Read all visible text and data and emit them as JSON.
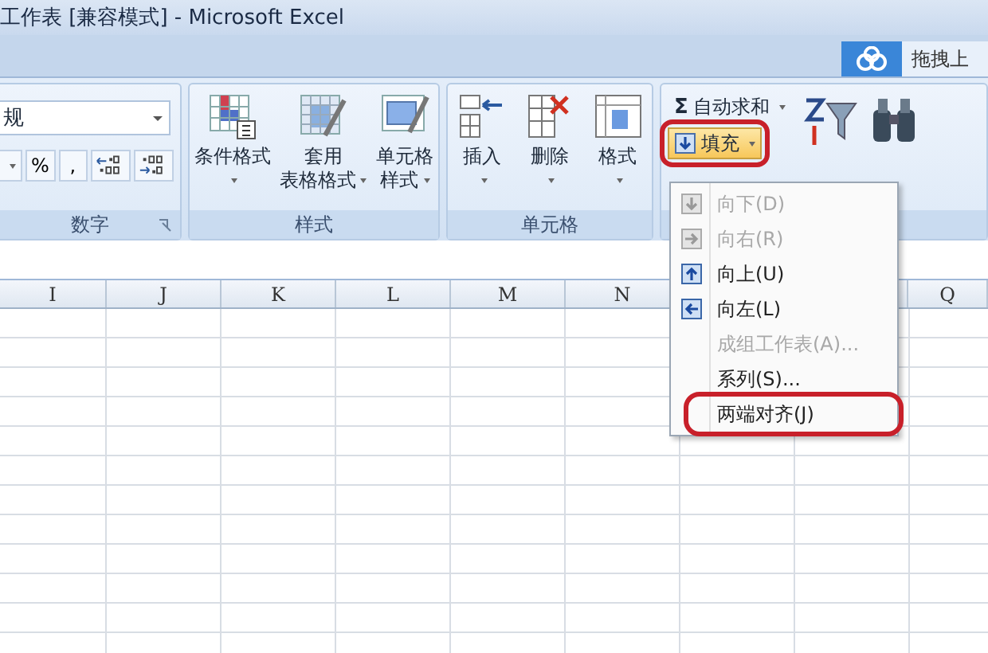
{
  "window": {
    "title": "工作表 [兼容模式] - Microsoft Excel"
  },
  "upload_button": {
    "label": "拖拽上"
  },
  "ribbon": {
    "number_group": {
      "label": "数字",
      "format_value": "规",
      "percent": "%",
      "comma": ","
    },
    "styles_group": {
      "label": "样式",
      "buttons": [
        {
          "lines": [
            "条件格式"
          ],
          "dropdown": true
        },
        {
          "lines": [
            "套用",
            "表格格式"
          ],
          "dropdown": true
        },
        {
          "lines": [
            "单元格",
            "样式"
          ],
          "dropdown": true
        }
      ]
    },
    "cells_group": {
      "label": "单元格",
      "buttons": [
        {
          "lines": [
            "插入"
          ],
          "dropdown": true
        },
        {
          "lines": [
            "删除"
          ],
          "dropdown": true
        },
        {
          "lines": [
            "格式"
          ],
          "dropdown": true
        }
      ]
    },
    "editing_group": {
      "autosum": {
        "symbol": "Σ",
        "label": "自动求和"
      },
      "fill": {
        "label": "填充",
        "pressed": true,
        "highlighted": true
      }
    }
  },
  "columns": [
    {
      "label": "I"
    },
    {
      "label": "J"
    },
    {
      "label": "K"
    },
    {
      "label": "L"
    },
    {
      "label": "M"
    },
    {
      "label": "N"
    },
    {},
    {},
    {
      "label": "Q"
    }
  ],
  "fill_menu": {
    "items": [
      {
        "kind": "direction",
        "label": "向下(D)",
        "disabled": true,
        "highlighted": false
      },
      {
        "kind": "direction",
        "label": "向右(R)",
        "disabled": true,
        "highlighted": false
      },
      {
        "kind": "direction",
        "label": "向上(U)",
        "disabled": false,
        "highlighted": false
      },
      {
        "kind": "direction",
        "label": "向左(L)",
        "disabled": false,
        "highlighted": false
      },
      {
        "kind": "command",
        "label": "成组工作表(A)...",
        "disabled": true,
        "highlighted": false
      },
      {
        "kind": "command",
        "label": "系列(S)...",
        "disabled": false,
        "highlighted": false
      },
      {
        "kind": "command",
        "label": "两端对齐(J)",
        "disabled": false,
        "highlighted": true
      }
    ]
  }
}
